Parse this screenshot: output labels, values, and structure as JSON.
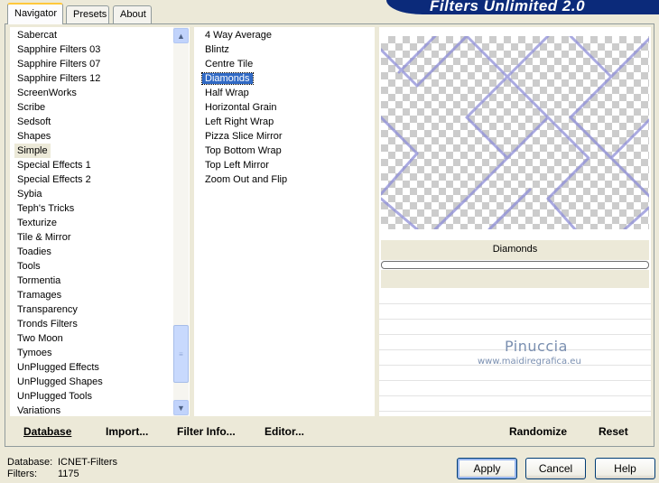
{
  "banner": {
    "title": "Filters Unlimited 2.0"
  },
  "tabs": [
    {
      "label": "Navigator",
      "active": true
    },
    {
      "label": "Presets",
      "active": false
    },
    {
      "label": "About",
      "active": false
    }
  ],
  "categories": {
    "items": [
      "Sabercat",
      "Sapphire Filters 03",
      "Sapphire Filters 07",
      "Sapphire Filters 12",
      "ScreenWorks",
      "Scribe",
      "Sedsoft",
      "Shapes",
      "Simple",
      "Special Effects 1",
      "Special Effects 2",
      "Sybia",
      "Teph's Tricks",
      "Texturize",
      "Tile & Mirror",
      "Toadies",
      "Tools",
      "Tormentia",
      "Tramages",
      "Transparency",
      "Tronds Filters",
      "Two Moon",
      "Tymoes",
      "UnPlugged Effects",
      "UnPlugged Shapes",
      "UnPlugged Tools",
      "Variations"
    ],
    "highlighted": "Simple",
    "scroll_position": 0.8
  },
  "filters": {
    "items": [
      "4 Way Average",
      "Blintz",
      "Centre Tile",
      "Diamonds",
      "Half Wrap",
      "Horizontal Grain",
      "Left Right Wrap",
      "Pizza Slice Mirror",
      "Top Bottom Wrap",
      "Top Left Mirror",
      "Zoom Out and Flip"
    ],
    "selected": "Diamonds"
  },
  "preview": {
    "filter_name": "Diamonds",
    "line_color": "#8e8ed8"
  },
  "watermark": {
    "line1": "Pinuccia",
    "line2": "www.maidiregrafica.eu"
  },
  "toolbar": {
    "database": "Database",
    "import": "Import...",
    "filter_info": "Filter Info...",
    "editor": "Editor...",
    "randomize": "Randomize",
    "reset": "Reset"
  },
  "status": {
    "database_label": "Database:",
    "database_value": "ICNET-Filters",
    "filters_label": "Filters:",
    "filters_value": "1175"
  },
  "buttons": {
    "apply": "Apply",
    "cancel": "Cancel",
    "help": "Help"
  },
  "colors": {
    "selection": "#316ac5",
    "banner": "#0b2a7a",
    "window": "#ece9d8"
  }
}
